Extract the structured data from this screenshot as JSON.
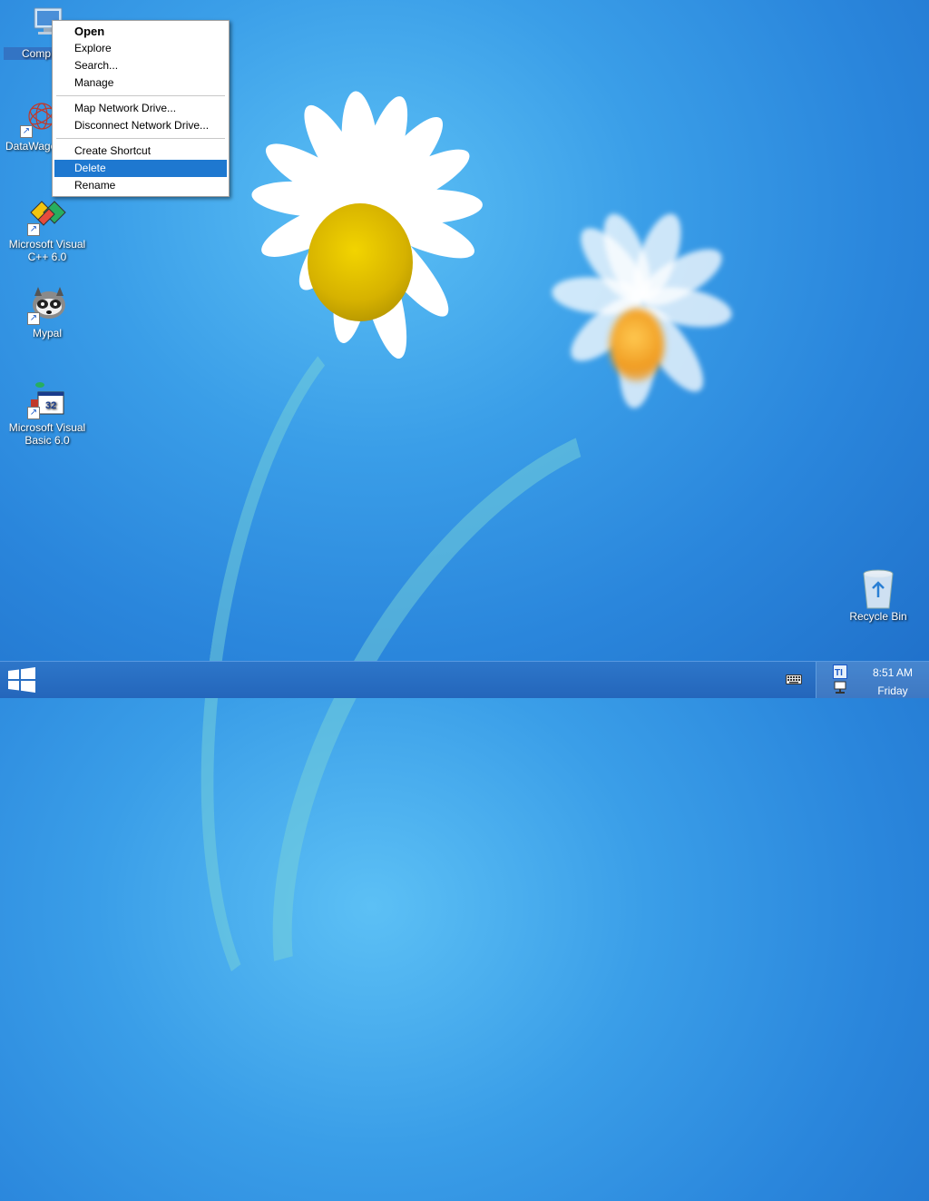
{
  "desktop": {
    "icons": [
      {
        "label": "Comp",
        "icon": "computer-icon",
        "selected": true
      },
      {
        "label": "DataWage",
        "icon": "datawage-icon"
      },
      {
        "label": "Microsoft Visual C++ 6.0",
        "icon": "visual-cpp-icon"
      },
      {
        "label": "Mypal",
        "icon": "mypal-raccoon-icon"
      },
      {
        "label": "Microsoft Visual Basic 6.0",
        "icon": "visual-basic-icon"
      },
      {
        "label": "Recycle Bin",
        "icon": "recycle-bin-icon"
      }
    ]
  },
  "context_menu": {
    "items": [
      {
        "label": "Open",
        "bold": true
      },
      {
        "label": "Explore"
      },
      {
        "label": "Search..."
      },
      {
        "label": "Manage"
      },
      {
        "label": "Map Network Drive..."
      },
      {
        "label": "Disconnect Network Drive..."
      },
      {
        "label": "Create Shortcut"
      },
      {
        "label": "Delete",
        "highlighted": true
      },
      {
        "label": "Rename"
      }
    ]
  },
  "taskbar": {
    "time": "8:51 AM",
    "day": "Friday"
  },
  "colors": {
    "menu_highlight": "#1e78d0",
    "taskbar": "#2466bb"
  }
}
